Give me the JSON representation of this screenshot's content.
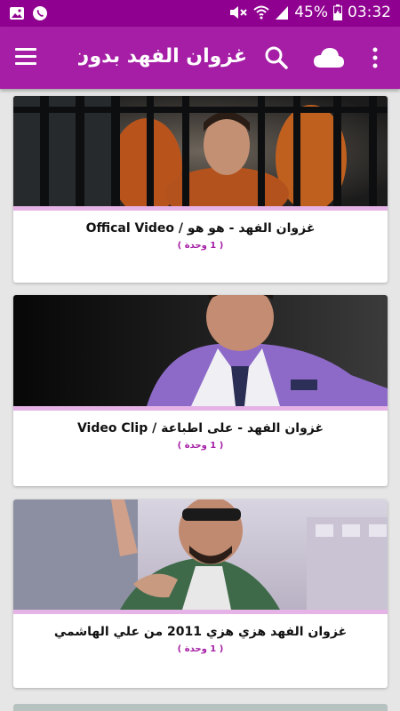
{
  "status_bar": {
    "battery": "45%",
    "time": "03:32",
    "icons": [
      "image-icon",
      "whatsapp-icon",
      "mute-icon",
      "wifi-icon",
      "signal-icon",
      "battery-icon"
    ]
  },
  "app_bar": {
    "title": "غزوان الفهد بدون ...",
    "icons": [
      "menu-icon",
      "search-icon",
      "cloud-icon",
      "more-icon"
    ]
  },
  "videos": [
    {
      "title": "غزوان الفهد - هو هو / Offical Video",
      "subtitle": "( 1 وحدة )"
    },
    {
      "title": "غزوان الفهد - على اطباعة / Video Clip",
      "subtitle": "( 1 وحدة )"
    },
    {
      "title": "غزوان الفهد هزي هزي 2011 من علي الهاشمي",
      "subtitle": "( 1 وحدة )"
    }
  ],
  "colors": {
    "status_bar": "#900090",
    "app_bar": "#a51ea5",
    "accent_divider": "#e6b3e6",
    "background": "#e6e6e6"
  }
}
